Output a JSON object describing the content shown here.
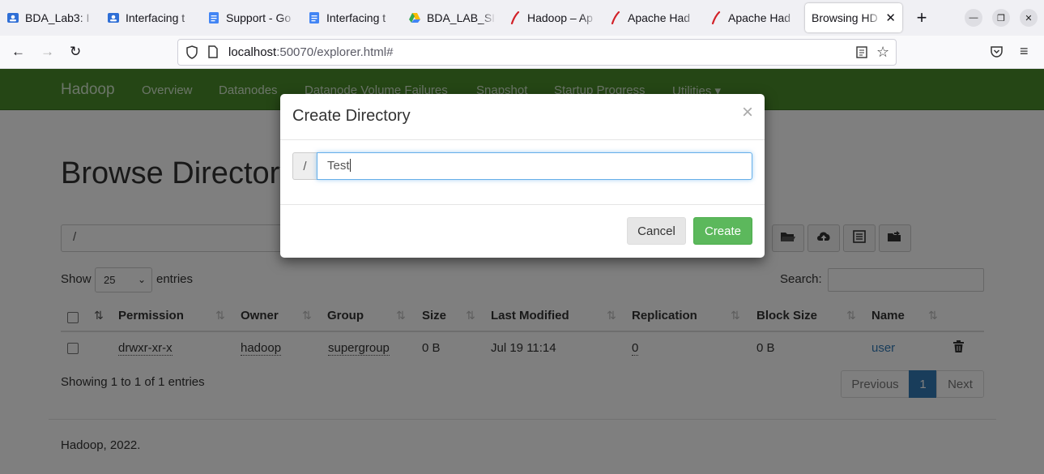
{
  "browser": {
    "tabs": [
      {
        "title": "BDA_Lab3: I",
        "favicon": "classroom-icon",
        "active": false
      },
      {
        "title": "Interfacing t",
        "favicon": "classroom-icon",
        "active": false
      },
      {
        "title": "Support - Go",
        "favicon": "docs-icon",
        "active": false
      },
      {
        "title": "Interfacing t",
        "favicon": "docs-icon",
        "active": false
      },
      {
        "title": "BDA_LAB_SI",
        "favicon": "drive-icon",
        "active": false
      },
      {
        "title": "Hadoop – Ap",
        "favicon": "apache-feather-icon",
        "active": false
      },
      {
        "title": "Apache Had",
        "favicon": "apache-feather-icon",
        "active": false
      },
      {
        "title": "Apache Had",
        "favicon": "apache-feather-icon",
        "active": false
      },
      {
        "title": "Browsing HD",
        "favicon": "none",
        "active": true
      }
    ],
    "new_tab": "+",
    "url_host": "localhost",
    "url_rest": ":50070/explorer.html#"
  },
  "hadoop": {
    "brand": "Hadoop",
    "nav": [
      "Overview",
      "Datanodes",
      "Datanode Volume Failures",
      "Snapshot",
      "Startup Progress",
      "Utilities"
    ],
    "nav_caret": "▾",
    "page_title": "Browse Directory",
    "path_value": "/",
    "show_label": "Show",
    "entries_value": "25",
    "entries_label": "entries",
    "search_label": "Search:",
    "columns": [
      "Permission",
      "Owner",
      "Group",
      "Size",
      "Last Modified",
      "Replication",
      "Block Size",
      "Name"
    ],
    "row": {
      "permission": "drwxr-xr-x",
      "owner": "hadoop",
      "group": "supergroup",
      "size": "0 B",
      "last_modified": "Jul 19 11:14",
      "replication": "0",
      "block_size": "0 B",
      "name": "user"
    },
    "info": "Showing 1 to 1 of 1 entries",
    "pager": {
      "previous": "Previous",
      "current": "1",
      "next": "Next"
    },
    "footer": "Hadoop, 2022."
  },
  "modal": {
    "title": "Create Directory",
    "close": "×",
    "prefix": "/",
    "input_value": "Test",
    "cancel": "Cancel",
    "create": "Create"
  },
  "colors": {
    "navbar_green": "#4a8c2a",
    "create_green": "#5cb85c",
    "link_blue": "#337ab7",
    "pager_active": "#337ab7"
  }
}
